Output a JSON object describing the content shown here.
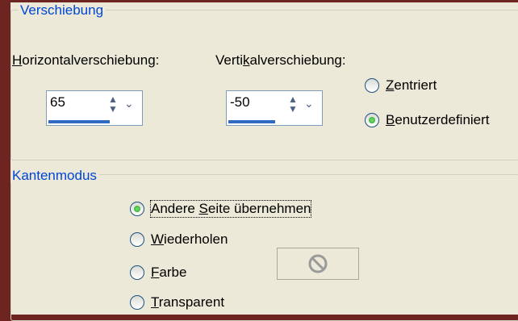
{
  "shift_group": {
    "title": "Verschiebung",
    "horizontal_label_pre": "",
    "horizontal_label_u": "H",
    "horizontal_label_post": "orizontalverschiebung:",
    "horizontal_value": "65",
    "vertical_label_pre": "Verti",
    "vertical_label_u": "k",
    "vertical_label_post": "alverschiebung:",
    "vertical_value": "-50",
    "radio_centered_u": "Z",
    "radio_centered_rest": "entriert",
    "radio_custom_u": "B",
    "radio_custom_rest": "enutzerdefiniert",
    "selected": "custom"
  },
  "edge_group": {
    "title": "Kantenmodus",
    "options": [
      {
        "pre": "Andere ",
        "u": "S",
        "post": "eite übernehmen",
        "selected": true
      },
      {
        "pre": "",
        "u": "W",
        "post": "iederholen",
        "selected": false
      },
      {
        "pre": "",
        "u": "F",
        "post": "arbe",
        "selected": false
      },
      {
        "pre": "",
        "u": "T",
        "post": "ransparent",
        "selected": false
      }
    ],
    "color_icon": "no-color-icon"
  },
  "colors": {
    "frame": "#6e2522",
    "panel": "#ece9d8",
    "group_title": "#0046d5",
    "spin_bar": "#316ac5",
    "radio_dot": "#21a121"
  }
}
